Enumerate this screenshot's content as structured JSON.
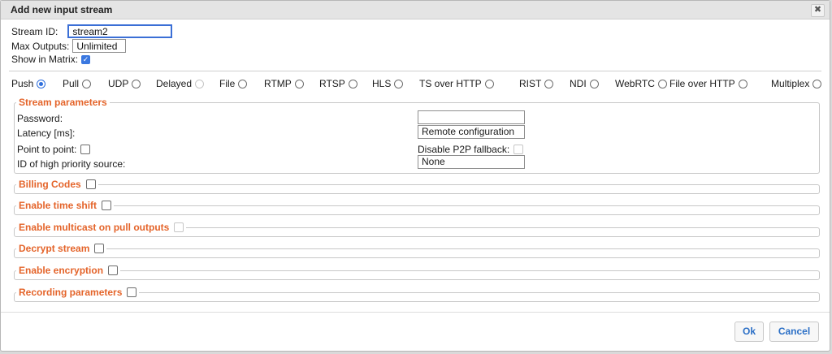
{
  "dialog": {
    "title": "Add new input stream",
    "close_glyph": "✖"
  },
  "form": {
    "stream_id_label": "Stream ID:",
    "stream_id_value": "stream2",
    "max_outputs_label": "Max Outputs:",
    "max_outputs_value": "Unlimited",
    "show_in_matrix_label": "Show in Matrix:",
    "show_in_matrix_checked": true
  },
  "input_types": [
    {
      "label": "Push",
      "selected": true,
      "disabled": false
    },
    {
      "label": "Pull",
      "selected": false,
      "disabled": false
    },
    {
      "label": "UDP",
      "selected": false,
      "disabled": false
    },
    {
      "label": "Delayed",
      "selected": false,
      "disabled": true
    },
    {
      "label": "File",
      "selected": false,
      "disabled": false
    },
    {
      "label": "RTMP",
      "selected": false,
      "disabled": false
    },
    {
      "label": "RTSP",
      "selected": false,
      "disabled": false
    },
    {
      "label": "HLS",
      "selected": false,
      "disabled": false
    },
    {
      "label": "TS over HTTP",
      "selected": false,
      "disabled": false
    },
    {
      "label": "RIST",
      "selected": false,
      "disabled": false
    },
    {
      "label": "NDI",
      "selected": false,
      "disabled": false
    },
    {
      "label": "WebRTC",
      "selected": false,
      "disabled": false
    },
    {
      "label": "File over HTTP",
      "selected": false,
      "disabled": false
    },
    {
      "label": "Multiplex",
      "selected": false,
      "disabled": false
    }
  ],
  "stream_parameters": {
    "legend": "Stream parameters",
    "password_label": "Password:",
    "password_value": "",
    "latency_label": "Latency [ms]:",
    "latency_value": "Remote configuration",
    "p2p_label": "Point to point:",
    "disable_p2p_label": "Disable P2P fallback:",
    "priority_label": "ID of high priority source:",
    "priority_value": "None"
  },
  "sections": {
    "billing": "Billing Codes",
    "timeshift": "Enable time shift",
    "multicast": "Enable multicast on pull outputs",
    "decrypt": "Decrypt stream",
    "encryption": "Enable encryption",
    "recording": "Recording parameters"
  },
  "buttons": {
    "ok": "Ok",
    "cancel": "Cancel"
  },
  "colors": {
    "accent": "#e4642a",
    "link": "#2b6fc6",
    "focus": "#3b6fd6"
  }
}
